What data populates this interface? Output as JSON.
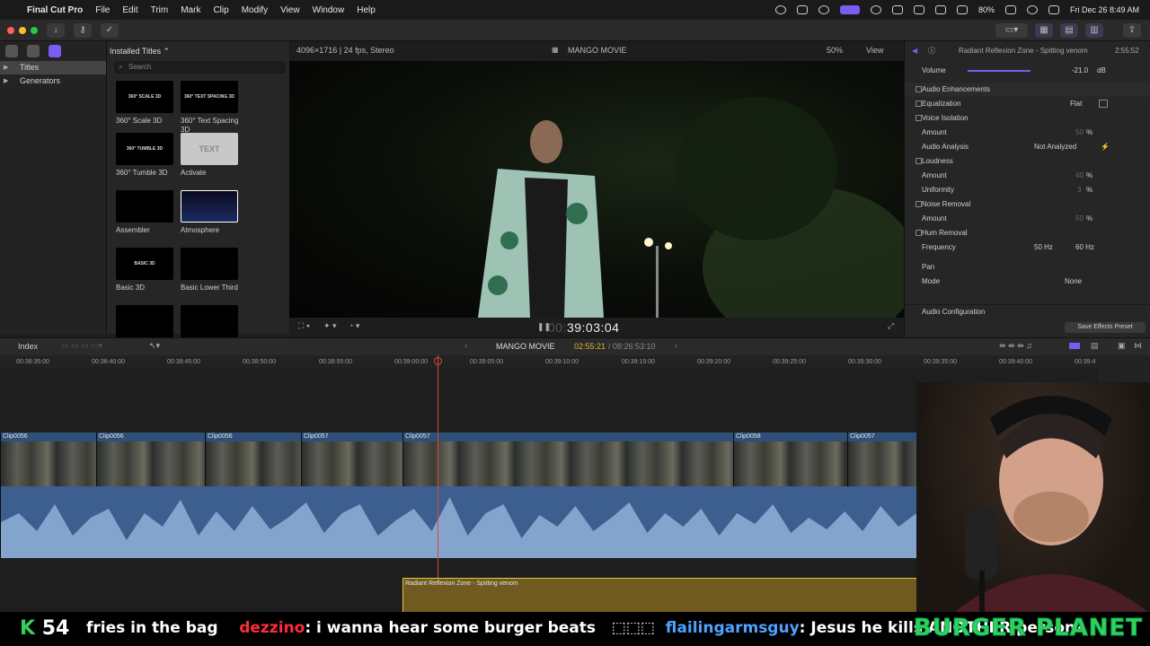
{
  "menubar": {
    "app_name": "Final Cut Pro",
    "menus": [
      "File",
      "Edit",
      "Trim",
      "Mark",
      "Clip",
      "Modify",
      "View",
      "Window",
      "Help"
    ],
    "battery": "80%",
    "clock": "Fri Dec 26  8:49 AM"
  },
  "sidebar": {
    "items": [
      {
        "label": "Titles",
        "selected": true
      },
      {
        "label": "Generators",
        "selected": false
      }
    ]
  },
  "browser": {
    "header": "Installed Titles",
    "search_placeholder": "Search",
    "tiles": [
      {
        "thumb": "360° SCALE 3D",
        "caption": "360° Scale 3D"
      },
      {
        "thumb": "360° TEXT SPACING 3D",
        "caption": "360° Text Spacing 3D"
      },
      {
        "thumb": "360° TUMBLE 3D",
        "caption": "360° Tumble 3D"
      },
      {
        "thumb": "TEXT",
        "caption": "Activate"
      },
      {
        "thumb": "",
        "caption": "Assembler"
      },
      {
        "thumb": "",
        "caption": "Atmosphere"
      },
      {
        "thumb": "BASIC 3D",
        "caption": "Basic 3D"
      },
      {
        "thumb": "",
        "caption": "Basic Lower Third"
      },
      {
        "thumb": "",
        "caption": ""
      },
      {
        "thumb": "",
        "caption": ""
      }
    ]
  },
  "viewer": {
    "format": "4096×1716 | 24 fps, Stereo",
    "project": "MANGO MOVIE",
    "zoom": "50%",
    "view_label": "View",
    "timecode_dim": "00:",
    "timecode": "39:03:04"
  },
  "inspector": {
    "clip_title": "Radiant Reflexion Zone - Spitting venom",
    "duration": "2:55:52",
    "volume_label": "Volume",
    "volume_value": "-21.0",
    "volume_unit": "dB",
    "audio_enhancements": "Audio Enhancements",
    "equalization": "Equalization",
    "equalization_value": "Flat",
    "voice_isolation": "Voice Isolation",
    "amount": "Amount",
    "voice_amount": "50",
    "percent": "%",
    "audio_analysis": "Audio Analysis",
    "audio_analysis_value": "Not Analyzed",
    "loudness": "Loudness",
    "loudness_amount": "40",
    "uniformity": "Uniformity",
    "uniformity_value": "3",
    "noise_removal": "Noise Removal",
    "noise_amount": "50",
    "hum_removal": "Hum Removal",
    "frequency": "Frequency",
    "freq_50": "50 Hz",
    "freq_60": "60 Hz",
    "pan": "Pan",
    "mode": "Mode",
    "mode_value": "None",
    "audio_configuration": "Audio Configuration",
    "save_preset": "Save Effects Preset"
  },
  "timeline": {
    "index_label": "Index",
    "project": "MANGO MOVIE",
    "position": "02:55:21",
    "total": "08:26:53:10",
    "ruler": [
      "00:38:35:00",
      "00:38:40:00",
      "00:38:45:00",
      "00:38:50:00",
      "00:38:55:00",
      "00:39:00:00",
      "00:39:05:00",
      "00:39:10:00",
      "00:39:15:00",
      "00:39:20:00",
      "00:39:25:00",
      "00:39:30:00",
      "00:39:35:00",
      "00:39:40:00",
      "00:39:4"
    ],
    "clips": [
      "Clip0056",
      "Clip0056",
      "Clip0056",
      "Clip0057",
      "Clip0057",
      "Clip0058",
      "Clip0057"
    ],
    "title_clip": "Radiant Reflexion Zone - Spitting venom"
  },
  "ticker": {
    "count_letter": "K",
    "count": "54",
    "msg1": "fries in the bag",
    "user2": "dezzino",
    "msg2": ": i wanna hear some burger beats",
    "user3": "flailingarmsguy",
    "msg3": ": Jesus he kills ANOTHER person?",
    "brand": "BURGER PLANET"
  },
  "colors": {
    "accent": "#7b5cf0",
    "playhead": "#e0463a",
    "clip_blue": "#2d4f78",
    "title_clip_border": "#e6c53a",
    "ticker_green": "#34d058"
  }
}
